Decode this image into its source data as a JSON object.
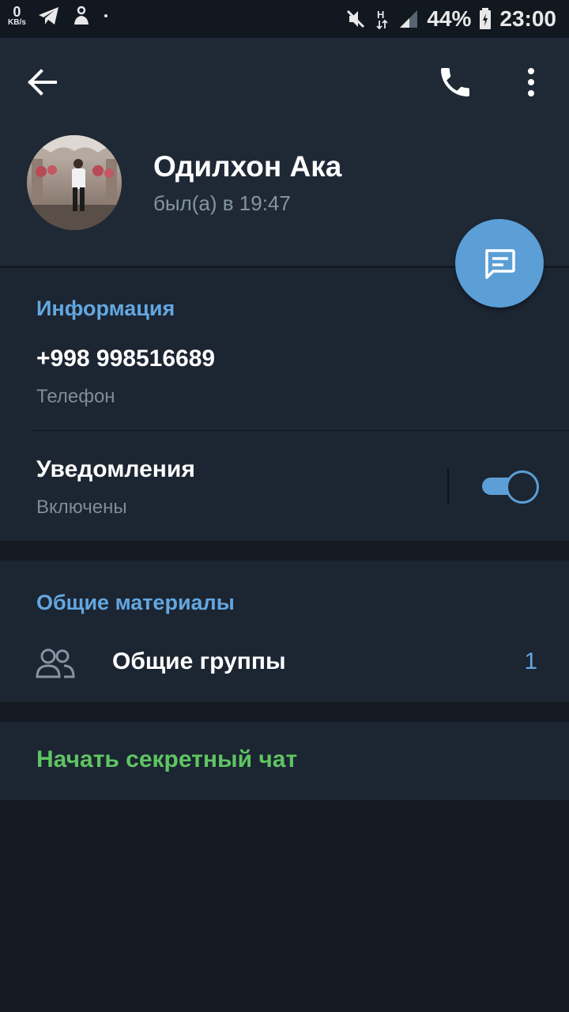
{
  "status_bar": {
    "net_speed_value": "0",
    "net_speed_unit": "KB/s",
    "left_icons": [
      "telegram-icon",
      "touch-icon",
      "dot-icon"
    ],
    "right_icons": [
      "mute-icon",
      "h-signal-icon",
      "signal-bars-icon",
      "battery-charging-icon"
    ],
    "battery_percent": "44%",
    "time": "23:00"
  },
  "header": {
    "back_icon": "arrow-left-icon",
    "call_icon": "phone-icon",
    "menu_icon": "more-vertical-icon"
  },
  "profile": {
    "name": "Одилхон Ака",
    "last_seen": "был(а) в 19:47",
    "fab_icon": "message-icon"
  },
  "info_section": {
    "title": "Информация",
    "phone_value": "+998 998516689",
    "phone_label": "Телефон",
    "notifications_label": "Уведомления",
    "notifications_status": "Включены",
    "notifications_enabled": true
  },
  "media_section": {
    "title": "Общие материалы",
    "groups_label": "Общие группы",
    "groups_count": "1",
    "groups_icon": "people-icon"
  },
  "secret_chat": {
    "label": "Начать секретный чат"
  },
  "colors": {
    "background": "#151b23",
    "header": "#1f2936",
    "section": "#1c2532",
    "accent_blue": "#63a7e0",
    "fab": "#5b9fd6",
    "secret_green": "#5fc463",
    "secondary_text": "#7e8c9a"
  }
}
